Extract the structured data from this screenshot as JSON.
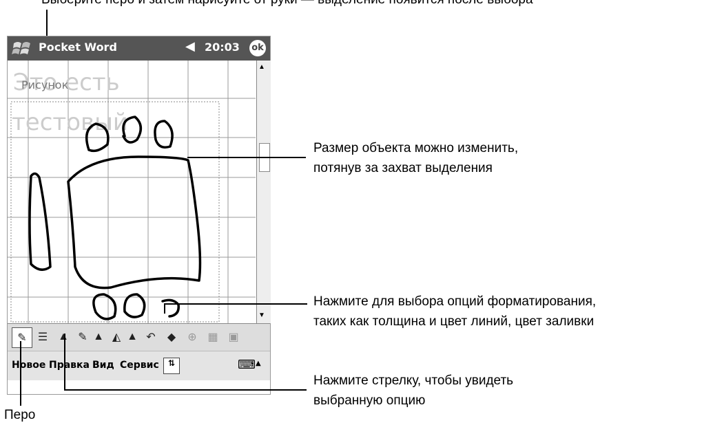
{
  "app": {
    "title": "Pocket Word",
    "time": "20:03",
    "ok_label": "ok"
  },
  "canvas": {
    "text_line1": "Это есть",
    "text_line2": "тестовый",
    "drawing_label": "Рисунок"
  },
  "menus": [
    "Новое",
    "Правка",
    "Вид",
    "Сервис"
  ],
  "callouts": {
    "resize": [
      "Размер объекта можно изменить,",
      "потянув за захват выделения"
    ],
    "format": [
      "Нажмите для выбора опций форматирования,",
      "таких как толщина и цвет линий, цвет заливки"
    ],
    "arrow": [
      "Нажмите стрелку, чтобы увидеть",
      "выбранную опцию"
    ],
    "pen": "Перо"
  },
  "icons": [
    "windows-start-icon",
    "speaker-icon",
    "ok-icon",
    "pen-icon",
    "line-thickness-icon",
    "arrow-icon",
    "line-color-icon",
    "fill-color-icon",
    "undo-icon",
    "shape-icon",
    "grid-icon",
    "keyboard-icon"
  ]
}
